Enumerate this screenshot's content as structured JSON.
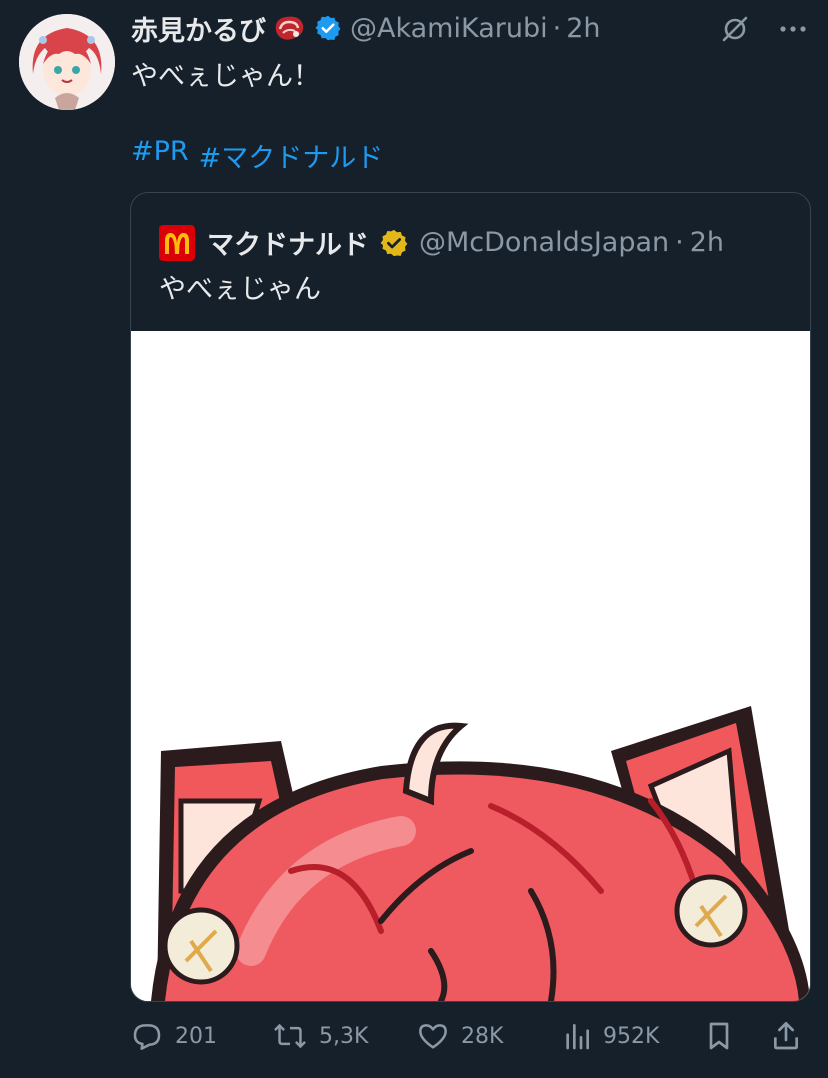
{
  "author": {
    "name": "赤見かるび",
    "handle": "@AkamiKarubi",
    "separator": "·",
    "time": "2h",
    "verified": true
  },
  "header_icons": [
    "grok-icon",
    "more-icon"
  ],
  "tweet": {
    "text": "やべぇじゃん！",
    "hashtags": [
      "#PR",
      "#マクドナルド"
    ]
  },
  "quote": {
    "name": "マクドナルド",
    "handle": "@McDonaldsJapan",
    "separator": "·",
    "time": "2h",
    "text": "やべぇじゃん",
    "badge": "gold-verified"
  },
  "actions": {
    "replies": "201",
    "reposts": "5,3K",
    "likes": "28K",
    "views": "952K"
  },
  "colors": {
    "background": "#15202b",
    "link": "#1d9bf0",
    "secondary_text": "#8b98a5",
    "verified_blue": "#1d9bf0",
    "verified_gold": "#e2b719"
  }
}
